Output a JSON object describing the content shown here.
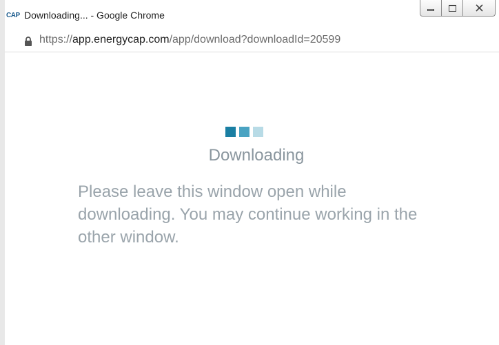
{
  "window": {
    "app_logo": "CAP",
    "title": "Downloading... - Google Chrome"
  },
  "controls": {
    "minimize": "minimize-icon",
    "maximize": "maximize-icon",
    "close": "close-icon",
    "close_glyph": "ꓫ"
  },
  "address": {
    "scheme": "https://",
    "host": "app.energycap.com",
    "path": "/app/download?downloadId=20599",
    "lock_icon": "lock-icon"
  },
  "page": {
    "heading": "Downloading",
    "message": "Please leave this window open while downloading. You may continue working in the other window.",
    "loader_colors": [
      "#1a7fa3",
      "#4aa3c2",
      "#b8dbe6"
    ]
  }
}
